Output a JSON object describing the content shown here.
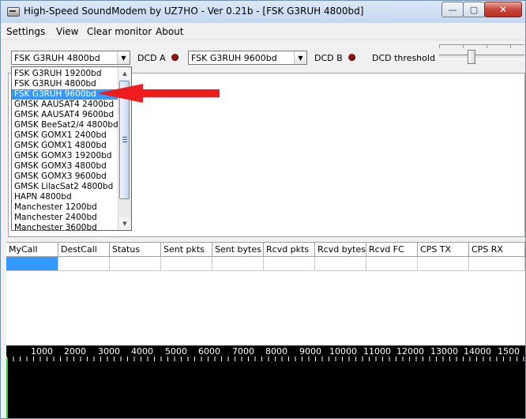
{
  "window": {
    "title": "High-Speed SoundModem by UZ7HO - Ver 0.21b - [FSK G3RUH 4800bd]"
  },
  "controls": {
    "minimize": "—",
    "maximize": "▢",
    "close": "✕"
  },
  "menu": [
    "Settings",
    "View",
    "Clear monitor",
    "About"
  ],
  "toolbar": {
    "modem_a": "FSK G3RUH 4800bd",
    "dcd_a_label": "DCD A",
    "modem_b": "FSK G3RUH 9600bd",
    "dcd_b_label": "DCD B",
    "dcd_threshold_label": "DCD threshold",
    "led_color": "#8b1a12"
  },
  "dropdown": {
    "selected_index": 2,
    "items": [
      "FSK G3RUH 19200bd",
      "FSK G3RUH 4800bd",
      "FSK G3RUH 9600bd",
      "GMSK AAUSAT4 2400bd",
      "GMSK AAUSAT4 9600bd",
      "GMSK BeeSat2/4 4800bd",
      "GMSK GOMX1 2400bd",
      "GMSK GOMX1 4800bd",
      "GMSK GOMX3 19200bd",
      "GMSK GOMX3 4800bd",
      "GMSK GOMX3 9600bd",
      "GMSK LilacSat2 4800bd",
      "HAPN 4800bd",
      "Manchester 1200bd",
      "Manchester 2400bd",
      "Manchester 3600bd"
    ]
  },
  "table": {
    "columns": [
      "MyCall",
      "DestCall",
      "Status",
      "Sent pkts",
      "Sent bytes",
      "Rcvd pkts",
      "Rcvd bytes",
      "Rcvd FC",
      "CPS TX",
      "CPS RX"
    ]
  },
  "spectrum": {
    "scale": [
      "1000",
      "2000",
      "3000",
      "4000",
      "5000",
      "6000",
      "7000",
      "8000",
      "9000",
      "10000",
      "11000",
      "12000",
      "13000",
      "14000",
      "1500"
    ]
  }
}
